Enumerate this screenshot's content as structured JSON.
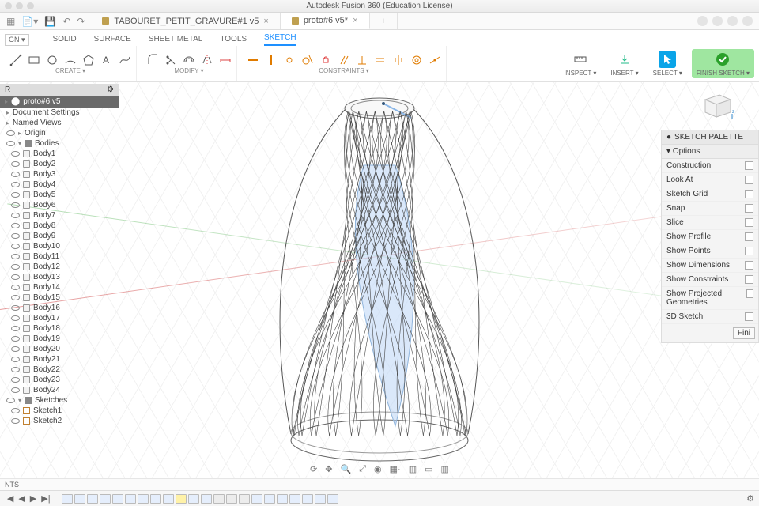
{
  "window": {
    "title": "Autodesk Fusion 360 (Education License)"
  },
  "tabs": {
    "items": [
      {
        "label": "TABOURET_PETIT_GRAVURE#1 v5",
        "active": false
      },
      {
        "label": "proto#6 v5*",
        "active": true
      }
    ]
  },
  "design_mode_label": "GN ▾",
  "menutabs": [
    {
      "label": "SOLID"
    },
    {
      "label": "SURFACE"
    },
    {
      "label": "SHEET METAL"
    },
    {
      "label": "TOOLS"
    },
    {
      "label": "SKETCH",
      "active": true
    }
  ],
  "ribbon": {
    "groups": {
      "create": "CREATE ▾",
      "modify": "MODIFY ▾",
      "constraints": "CONSTRAINTS ▾",
      "inspect": "INSPECT ▾",
      "insert": "INSERT ▾",
      "select": "SELECT ▾",
      "finish": "FINISH SKETCH ▾"
    }
  },
  "browser": {
    "title": "R",
    "root": "proto#6 v5",
    "doc_settings": "Document Settings",
    "named_views": "Named Views",
    "origin": "Origin",
    "bodies_label": "Bodies",
    "bodies": [
      "Body1",
      "Body2",
      "Body3",
      "Body4",
      "Body5",
      "Body6",
      "Body7",
      "Body8",
      "Body9",
      "Body10",
      "Body11",
      "Body12",
      "Body13",
      "Body14",
      "Body15",
      "Body16",
      "Body17",
      "Body18",
      "Body19",
      "Body20",
      "Body21",
      "Body22",
      "Body23",
      "Body24"
    ],
    "sketches_label": "Sketches",
    "sketches": [
      "Sketch1",
      "Sketch2"
    ]
  },
  "palette": {
    "title": "SKETCH PALETTE",
    "section": "Options",
    "options": [
      "Construction",
      "Look At",
      "Sketch Grid",
      "Snap",
      "Slice",
      "Show Profile",
      "Show Points",
      "Show Dimensions",
      "Show Constraints",
      "Show Projected Geometries",
      "3D Sketch"
    ],
    "finish": "Fini"
  },
  "nts_label": "NTS",
  "viewbar_icons": [
    "orbit",
    "pan",
    "zoom",
    "fit",
    "look",
    "grid",
    "cam",
    "style",
    "eff",
    "slice"
  ]
}
